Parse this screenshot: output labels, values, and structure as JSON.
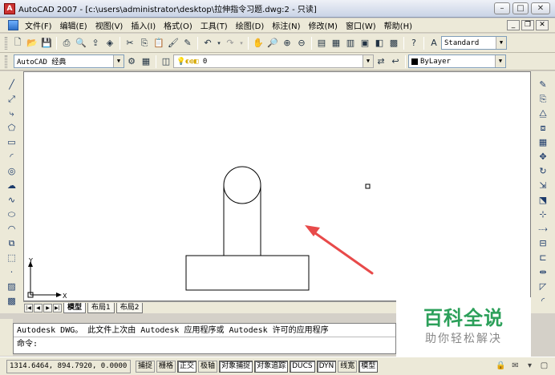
{
  "window": {
    "app_icon": "autocad-logo-icon",
    "title": "AutoCAD 2007 - [c:\\users\\administrator\\desktop\\拉伸指令习题.dwg:2 - 只读]",
    "buttons": [
      "minimize-icon",
      "maximize-icon",
      "close-icon"
    ]
  },
  "menubar": {
    "items": [
      "文件(F)",
      "编辑(E)",
      "视图(V)",
      "插入(I)",
      "格式(O)",
      "工具(T)",
      "绘图(D)",
      "标注(N)",
      "修改(M)",
      "窗口(W)",
      "帮助(H)"
    ]
  },
  "toolbar1": {
    "text_style": "Standard"
  },
  "toolbar2": {
    "workspace": "AutoCAD 经典",
    "layer": "0",
    "color": "ByLayer"
  },
  "drawing": {
    "ucs_y": "Y",
    "ucs_x": "X"
  },
  "layout_tabs": [
    "模型",
    "布局1",
    "布局2"
  ],
  "command": {
    "line1": "Autodesk DWG。  此文件上次由 Autodesk 应用程序或 Autodesk 许可的应用程序",
    "line2": "命令:"
  },
  "status": {
    "coords": "1314.6464,  894.7920,  0.0000",
    "buttons": [
      {
        "label": "捕捉",
        "on": false
      },
      {
        "label": "栅格",
        "on": false
      },
      {
        "label": "正交",
        "on": true
      },
      {
        "label": "极轴",
        "on": false
      },
      {
        "label": "对象捕捉",
        "on": true
      },
      {
        "label": "对象追踪",
        "on": true
      },
      {
        "label": "DUCS",
        "on": true
      },
      {
        "label": "DYN",
        "on": true
      },
      {
        "label": "线宽",
        "on": false
      },
      {
        "label": "模型",
        "on": true
      }
    ]
  },
  "watermark": {
    "title": "百科全说",
    "subtitle": "助你轻松解决"
  },
  "colors": {
    "arrow": "#e84a4a",
    "watermark": "#2ca05a"
  }
}
